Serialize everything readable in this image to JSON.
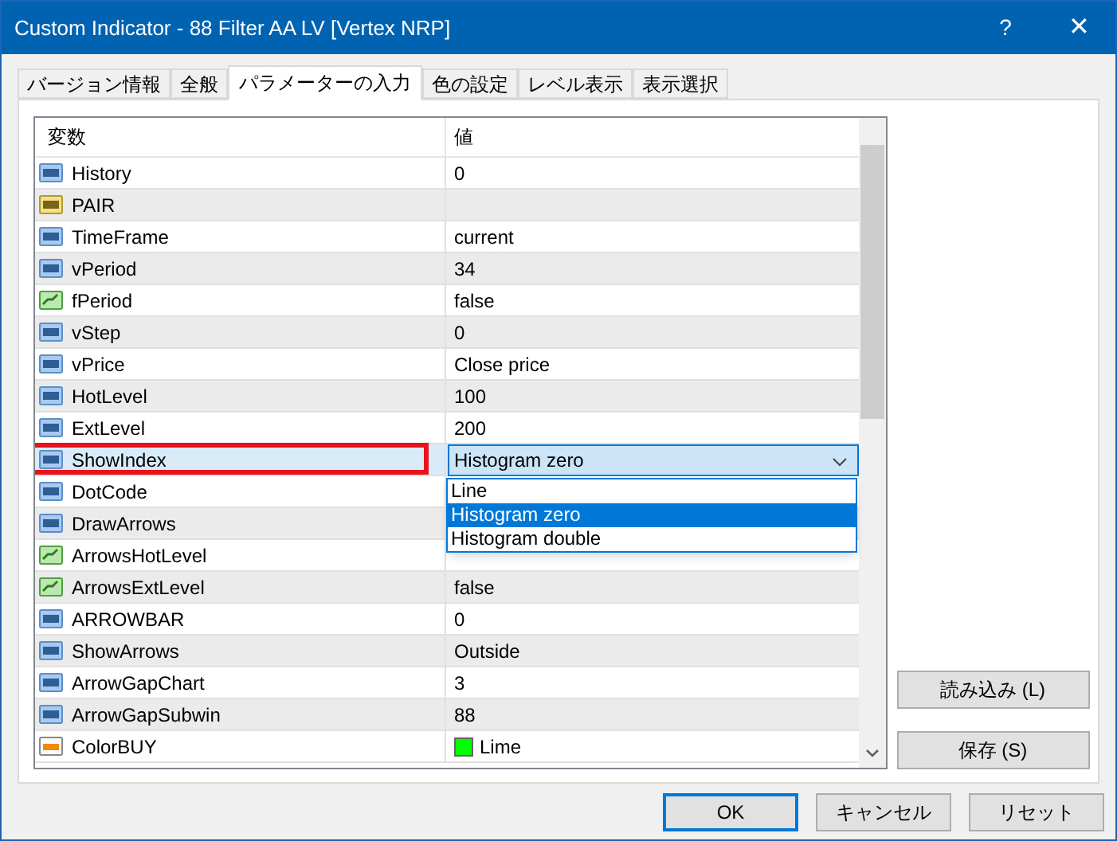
{
  "window": {
    "title": "Custom Indicator - 88 Filter AA LV [Vertex NRP]",
    "help": "?",
    "close": "✕"
  },
  "tabs": [
    {
      "label": "バージョン情報",
      "selected": false
    },
    {
      "label": "全般",
      "selected": false
    },
    {
      "label": "パラメーターの入力",
      "selected": true
    },
    {
      "label": "色の設定",
      "selected": false
    },
    {
      "label": "レベル表示",
      "selected": false
    },
    {
      "label": "表示選択",
      "selected": false
    }
  ],
  "table": {
    "columns": [
      "変数",
      "値"
    ],
    "rows": [
      {
        "kind": "int",
        "name": "History",
        "value": "0",
        "selected": false,
        "marked": false
      },
      {
        "kind": "string",
        "name": "PAIR",
        "value": "",
        "selected": false,
        "marked": false
      },
      {
        "kind": "int",
        "name": "TimeFrame",
        "value": "current",
        "selected": false,
        "marked": false
      },
      {
        "kind": "int",
        "name": "vPeriod",
        "value": "34",
        "selected": false,
        "marked": false
      },
      {
        "kind": "bool",
        "name": "fPeriod",
        "value": "false",
        "selected": false,
        "marked": false
      },
      {
        "kind": "int",
        "name": "vStep",
        "value": "0",
        "selected": false,
        "marked": false
      },
      {
        "kind": "int",
        "name": "vPrice",
        "value": "Close price",
        "selected": false,
        "marked": false
      },
      {
        "kind": "int",
        "name": "HotLevel",
        "value": "100",
        "selected": false,
        "marked": false
      },
      {
        "kind": "int",
        "name": "ExtLevel",
        "value": "200",
        "selected": false,
        "marked": false
      },
      {
        "kind": "int",
        "name": "ShowIndex",
        "value": "Histogram zero",
        "selected": true,
        "marked": true,
        "dropdown": {
          "options": [
            {
              "label": "Line",
              "selected": false
            },
            {
              "label": "Histogram zero",
              "selected": true
            },
            {
              "label": "Histogram double",
              "selected": false
            }
          ]
        }
      },
      {
        "kind": "int",
        "name": "DotCode",
        "value": "",
        "selected": false,
        "marked": false
      },
      {
        "kind": "int",
        "name": "DrawArrows",
        "value": "",
        "selected": false,
        "marked": false
      },
      {
        "kind": "bool",
        "name": "ArrowsHotLevel",
        "value": "",
        "selected": false,
        "marked": false
      },
      {
        "kind": "bool",
        "name": "ArrowsExtLevel",
        "value": "false",
        "selected": false,
        "marked": false
      },
      {
        "kind": "int",
        "name": "ARROWBAR",
        "value": "0",
        "selected": false,
        "marked": false
      },
      {
        "kind": "int",
        "name": "ShowArrows",
        "value": "Outside",
        "selected": false,
        "marked": false
      },
      {
        "kind": "int",
        "name": "ArrowGapChart",
        "value": "3",
        "selected": false,
        "marked": false
      },
      {
        "kind": "int",
        "name": "ArrowGapSubwin",
        "value": "88",
        "selected": false,
        "marked": false
      },
      {
        "kind": "color",
        "name": "ColorBUY",
        "value": "Lime",
        "color": "#00ff00",
        "selected": false,
        "marked": false
      }
    ]
  },
  "side_buttons": [
    "読み込み (L)",
    "保存 (S)"
  ],
  "buttons": [
    {
      "label": "OK",
      "default": true
    },
    {
      "label": "キャンセル",
      "default": false
    },
    {
      "label": "リセット",
      "default": false
    }
  ]
}
